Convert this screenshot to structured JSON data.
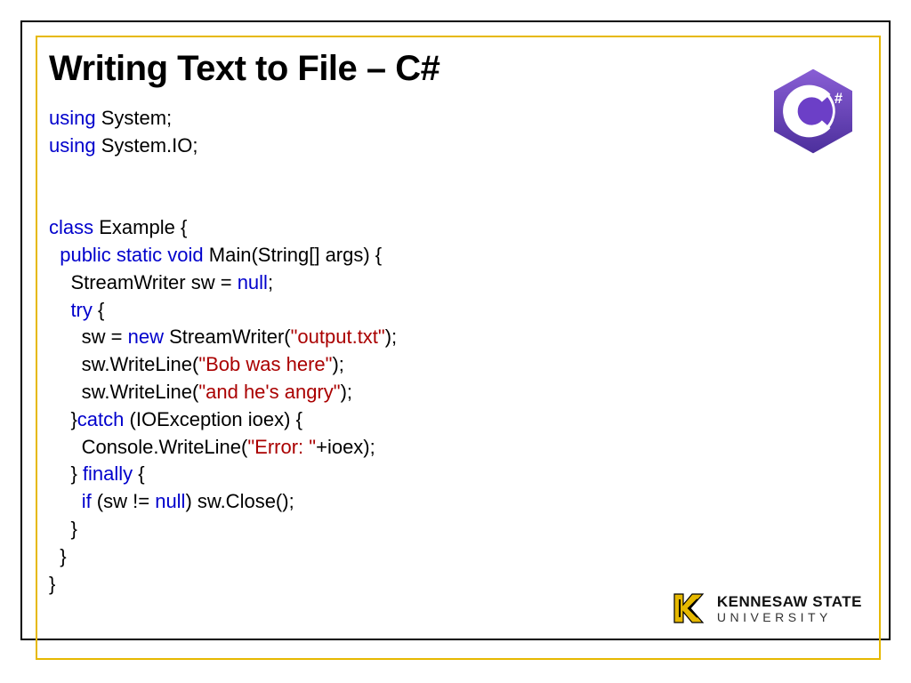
{
  "slide": {
    "title": "Writing Text to File – C#"
  },
  "code": {
    "using1_kw": "using",
    "using1_rest": " System;",
    "using2_kw": "using",
    "using2_rest": " System.IO;",
    "class_kw": "class",
    "class_rest": " Example {",
    "main_kw": "  public static void",
    "main_rest": " Main(String[] args) {",
    "sw_decl_pre": "    StreamWriter sw = ",
    "sw_decl_null": "null",
    "sw_decl_post": ";",
    "try_kw": "    try",
    "try_rest": " {",
    "new_pre": "      sw = ",
    "new_kw": "new",
    "new_mid": " StreamWriter(",
    "new_str": "\"output.txt\"",
    "new_post": ");",
    "wl1_pre": "      sw.WriteLine(",
    "wl1_str": "\"Bob was here\"",
    "wl1_post": ");",
    "wl2_pre": "      sw.WriteLine(",
    "wl2_str": "\"and he's angry\"",
    "wl2_post": ");",
    "catch_pre": "    }",
    "catch_kw": "catch",
    "catch_rest": " (IOException ioex) {",
    "err_pre": "      Console.WriteLine(",
    "err_str": "\"Error: \"",
    "err_post": "+ioex);",
    "finally_pre": "    } ",
    "finally_kw": "finally",
    "finally_rest": " {",
    "if_pre": "      ",
    "if_kw": "if",
    "if_mid": " (sw != ",
    "if_null": "null",
    "if_post": ") sw.Close();",
    "close1": "    }",
    "close2": "  }",
    "close3": "}"
  },
  "logo": {
    "csharp_letter": "C",
    "csharp_hash": "#",
    "ksu_main": "KENNESAW STATE",
    "ksu_sub": "UNIVERSITY"
  }
}
